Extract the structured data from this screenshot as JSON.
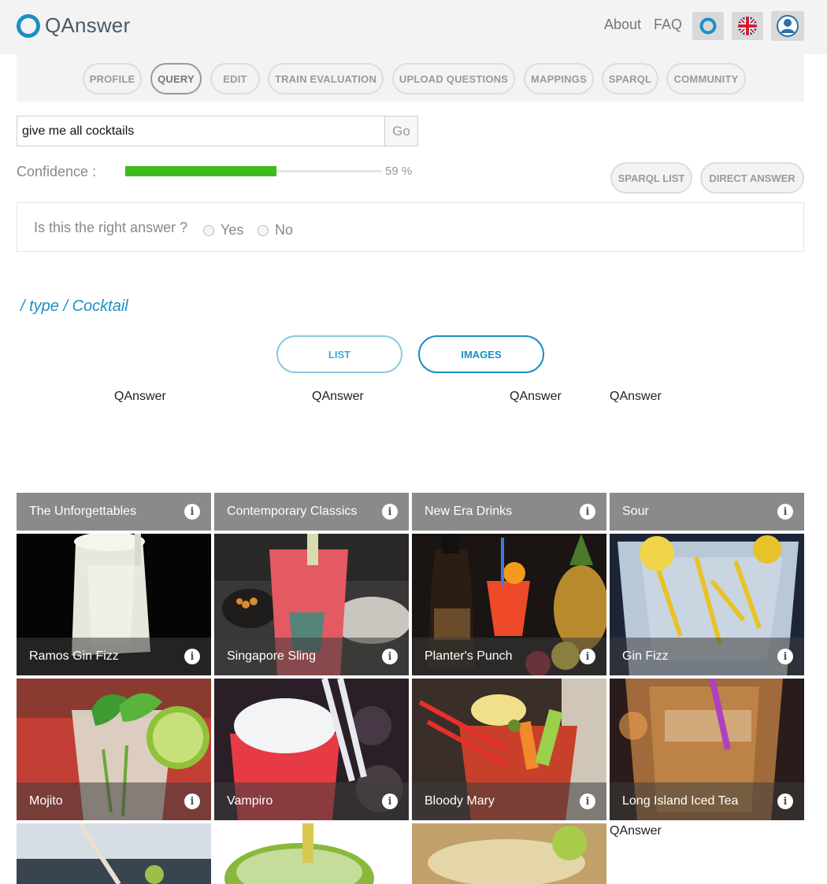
{
  "header": {
    "logo_text": "QAnswer",
    "links": [
      "About",
      "FAQ"
    ],
    "icons": [
      "qanswer-icon",
      "uk-flag-icon",
      "user-icon"
    ]
  },
  "nav": {
    "tabs": [
      "PROFILE",
      "QUERY",
      "EDIT",
      "TRAIN EVALUATION",
      "UPLOAD QUESTIONS",
      "MAPPINGS",
      "SPARQL",
      "COMMUNITY"
    ],
    "active": "QUERY"
  },
  "query": {
    "value": "give me all cocktails",
    "go_label": "Go"
  },
  "confidence": {
    "label": "Confidence :",
    "value": 59,
    "display": "59 %"
  },
  "actions": {
    "sparql_list": "SPARQL LIST",
    "direct_answer": "DIRECT ANSWER"
  },
  "feedback": {
    "question": "Is this the right answer ?",
    "yes": "Yes",
    "no": "No"
  },
  "breadcrumb": "/ type / Cocktail",
  "view": {
    "list": "LIST",
    "images": "IMAGES",
    "selected": "IMAGES"
  },
  "source_labels": [
    "QAnswer",
    "QAnswer",
    "QAnswer",
    "QAnswer",
    "QAnswer"
  ],
  "categories": [
    "The Unforgettables",
    "Contemporary Classics",
    "New Era Drinks",
    "Sour"
  ],
  "tiles": [
    {
      "name": "Ramos Gin Fizz"
    },
    {
      "name": "Singapore Sling"
    },
    {
      "name": "Planter's Punch"
    },
    {
      "name": "Gin Fizz"
    },
    {
      "name": "Mojito"
    },
    {
      "name": "Vampiro"
    },
    {
      "name": "Bloody Mary"
    },
    {
      "name": "Long Island Iced Tea"
    }
  ],
  "info_glyph": "i"
}
